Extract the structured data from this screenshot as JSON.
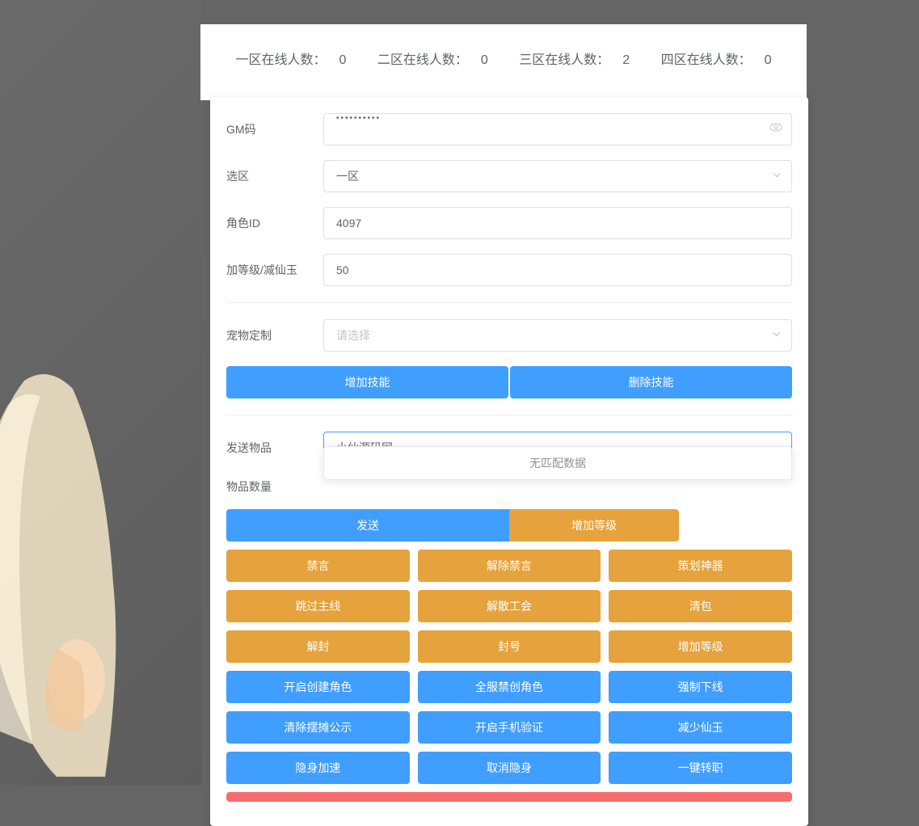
{
  "header": {
    "zone1_label": "一区在线人数：",
    "zone1_count": "0",
    "zone2_label": "二区在线人数：",
    "zone2_count": "0",
    "zone3_label": "三区在线人数：",
    "zone3_count": "2",
    "zone4_label": "四区在线人数：",
    "zone4_count": "0"
  },
  "form": {
    "gm_code_label": "GM码",
    "gm_code_value": "••••••••••",
    "zone_label": "选区",
    "zone_value": "一区",
    "role_id_label": "角色ID",
    "role_id_value": "4097",
    "level_label": "加等级/减仙玉",
    "level_value": "50",
    "pet_label": "宠物定制",
    "pet_placeholder": "请选择",
    "send_item_label": "发送物品",
    "send_item_value": "小仙源码网",
    "item_qty_label": "物品数量"
  },
  "dropdown": {
    "no_match": "无匹配数据"
  },
  "buttons": {
    "add_skill": "增加技能",
    "del_skill": "删除技能",
    "send": "发送",
    "add_level": "增加等级",
    "mute": "禁言",
    "unmute": "解除禁言",
    "planner": "策划神器",
    "skip_main": "跳过主线",
    "disband_guild": "解散工会",
    "clear_bag": "清包",
    "unban": "解封",
    "ban": "封号",
    "add_level2": "增加等级",
    "enable_create": "开启创建角色",
    "server_ban_create": "全服禁创角色",
    "force_offline": "强制下线",
    "clear_stall": "清除摆摊公示",
    "enable_phone": "开启手机验证",
    "reduce_jade": "减少仙玉",
    "stealth_speed": "隐身加速",
    "cancel_stealth": "取消隐身",
    "one_key_transfer": "一键转职"
  }
}
